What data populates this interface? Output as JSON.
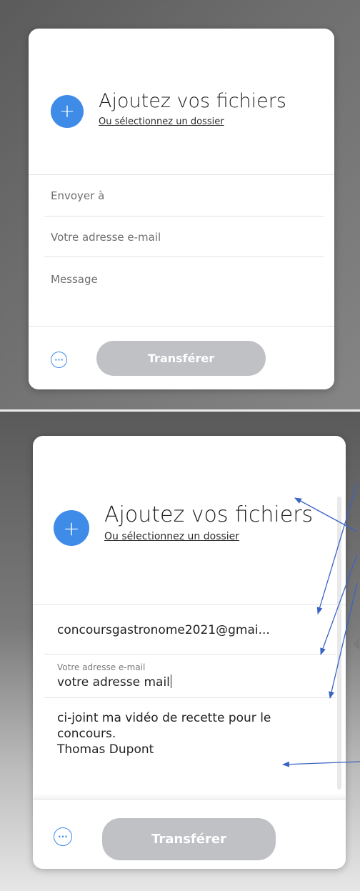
{
  "screen_before": {
    "add_files_title": "Ajoutez vos fichiers",
    "select_folder_link": "Ou sélectionnez un dossier",
    "plus_icon": "+",
    "send_to_placeholder": "Envoyer à",
    "email_placeholder": "Votre adresse e-mail",
    "message_placeholder": "Message",
    "more_icon": "···",
    "transfer_button": "Transférer"
  },
  "screen_after": {
    "add_files_title": "Ajoutez vos fichiers",
    "select_folder_link": "Ou sélectionnez un dossier",
    "plus_icon": "+",
    "send_to_value": "concoursgastronome2021@gmai...",
    "email_label": "Votre adresse e-mail",
    "email_value": "votre adresse mail",
    "message_lines": [
      "ci-joint ma vidéo de recette pour le",
      "concours.",
      "Thomas Dupont"
    ],
    "more_icon": "···",
    "transfer_button": "Transférer"
  },
  "colors": {
    "accent_blue": "#3e8ce8",
    "button_disabled": "#c0c1c5",
    "annotation_arrow": "#3b63c4"
  },
  "icons": [
    "plus-icon",
    "more-options-icon",
    "annotation-arrow"
  ]
}
